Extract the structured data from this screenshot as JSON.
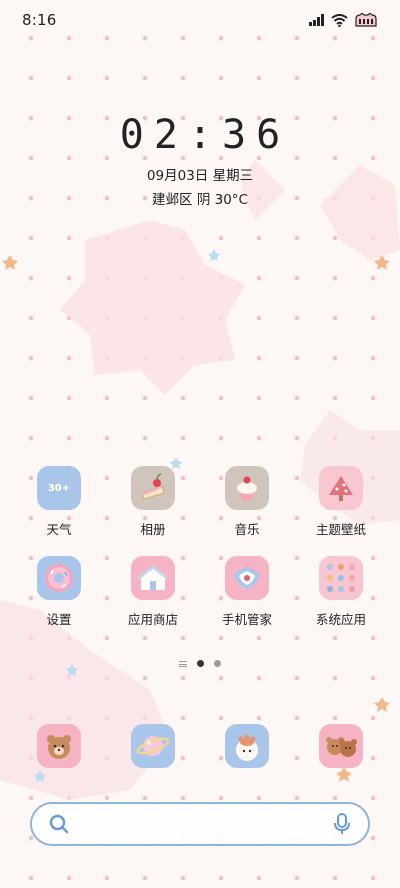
{
  "status_bar": {
    "time": "8:16",
    "icons": [
      "signal-icon",
      "wifi-icon",
      "battery-icon"
    ]
  },
  "clock": {
    "time": "02:36",
    "date": "09月03日 星期三",
    "weather": "建邺区 阴 30°C"
  },
  "apps": [
    {
      "name": "weather",
      "label": "天气",
      "icon": "weather-icon",
      "icon_text": "30+",
      "bg": "#a9c6ea"
    },
    {
      "name": "gallery",
      "label": "相册",
      "icon": "cake-icon",
      "bg": "#cfc5bd"
    },
    {
      "name": "music",
      "label": "音乐",
      "icon": "cupcake-icon",
      "bg": "#cfc5bd"
    },
    {
      "name": "themes",
      "label": "主题壁纸",
      "icon": "tree-icon",
      "bg": "#f8c7cf"
    },
    {
      "name": "settings",
      "label": "设置",
      "icon": "donut-icon",
      "bg": "#a9c6ea"
    },
    {
      "name": "app-store",
      "label": "应用商店",
      "icon": "house-icon",
      "bg": "#f5b3c4"
    },
    {
      "name": "phone-manager",
      "label": "手机管家",
      "icon": "shield-icon",
      "bg": "#f5b3c4"
    },
    {
      "name": "system-apps",
      "label": "系统应用",
      "icon": "folder-icon",
      "bg": "#f7c6d0"
    }
  ],
  "page_indicator": {
    "pages": 2,
    "active": 1
  },
  "dock": [
    {
      "name": "phone",
      "icon": "bear-icon",
      "bg": "#f5b3c4"
    },
    {
      "name": "browser",
      "icon": "planet-icon",
      "bg": "#a9c6ea"
    },
    {
      "name": "camera",
      "icon": "paw-icon",
      "bg": "#a9c6ea"
    },
    {
      "name": "messages",
      "icon": "bears-icon",
      "bg": "#f5b3c4"
    }
  ],
  "search": {
    "icons": [
      "search-icon",
      "mic-icon"
    ],
    "accent": "#6a9bd0"
  }
}
